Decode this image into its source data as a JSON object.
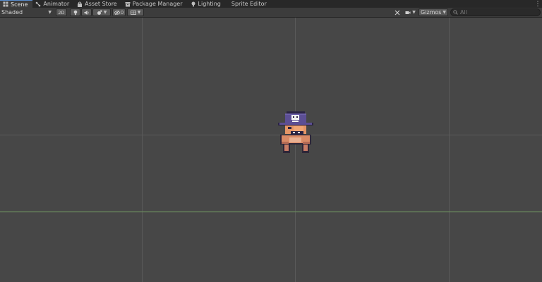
{
  "tabs": [
    {
      "label": "Scene",
      "icon": "scene-icon"
    },
    {
      "label": "Animator",
      "icon": "animator-icon"
    },
    {
      "label": "Asset Store",
      "icon": "store-bag-icon"
    },
    {
      "label": "Package Manager",
      "icon": "package-icon"
    },
    {
      "label": "Lighting",
      "icon": "lightbulb-icon"
    },
    {
      "label": "Sprite Editor",
      "icon": ""
    }
  ],
  "toolbar": {
    "draw_mode": "Shaded",
    "mode_2d": "2D",
    "hidden_count": "0",
    "gizmos_label": "Gizmos",
    "search_placeholder": "All"
  },
  "colors": {
    "viewport_bg": "#474747",
    "grid_line": "#5a5a5a",
    "x_axis": "#6a8a5e",
    "active_tab_accent": "#5a8fd0",
    "hat": "#5c4f94",
    "skin": "#e59566"
  }
}
